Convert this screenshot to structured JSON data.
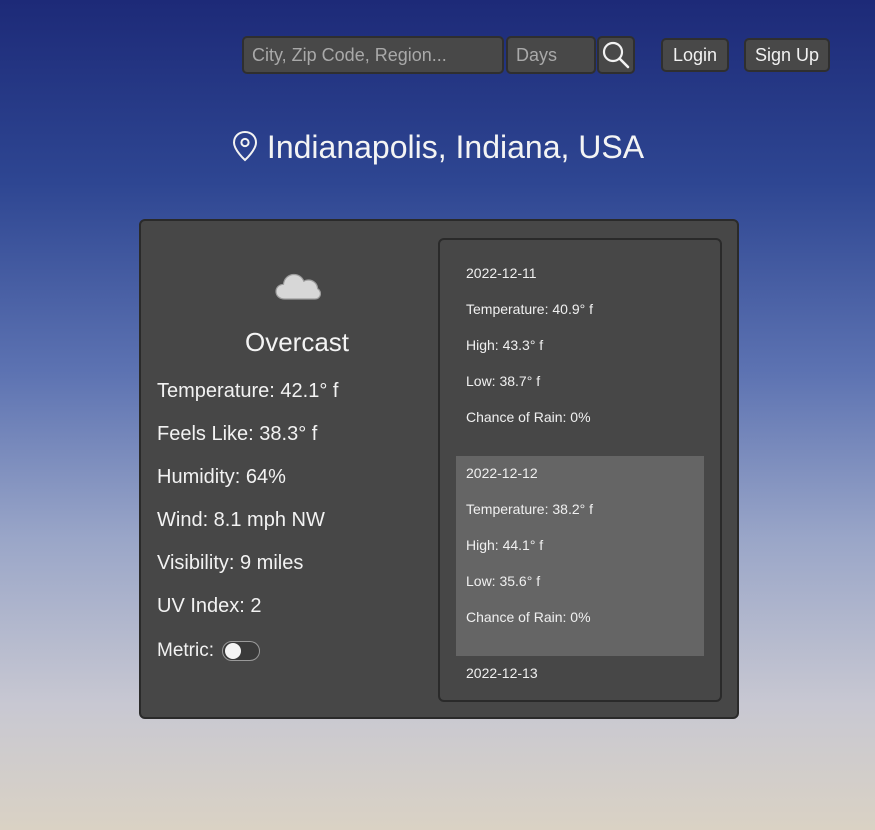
{
  "header": {
    "search_placeholder": "City, Zip Code, Region...",
    "days_placeholder": "Days",
    "search_button_icon": "search-icon",
    "login_label": "Login",
    "signup_label": "Sign Up"
  },
  "location": {
    "icon": "map-pin-icon",
    "name": "Indianapolis, Indiana, USA"
  },
  "current": {
    "icon": "cloud-icon",
    "condition": "Overcast",
    "temperature": "Temperature: 42.1° f",
    "feels_like": "Feels Like: 38.3° f",
    "humidity": "Humidity: 64%",
    "wind": "Wind: 8.1 mph NW",
    "visibility": "Visibility: 9 miles",
    "uv_index": "UV Index: 2",
    "metric_label": "Metric:",
    "metric_enabled": false
  },
  "forecast": [
    {
      "date": "2022-12-11",
      "temperature": "Temperature: 40.9° f",
      "high": "High: 43.3° f",
      "low": "Low: 38.7° f",
      "rain": "Chance of Rain: 0%"
    },
    {
      "date": "2022-12-12",
      "temperature": "Temperature: 38.2° f",
      "high": "High: 44.1° f",
      "low": "Low: 35.6° f",
      "rain": "Chance of Rain: 0%"
    },
    {
      "date": "2022-12-13"
    }
  ],
  "colors": {
    "card_background": "#474747",
    "highlight_background": "#656565",
    "gradient_top": "#1d2a78",
    "gradient_bottom": "#dad2c4"
  }
}
